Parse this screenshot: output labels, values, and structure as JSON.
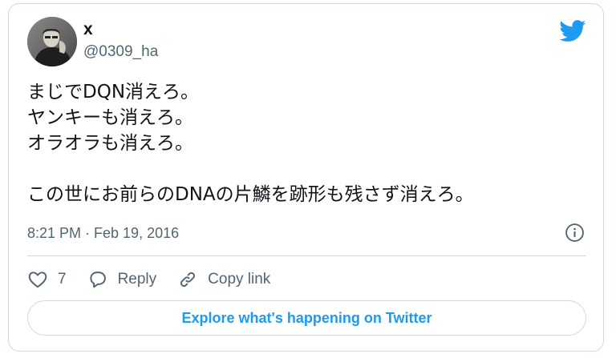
{
  "author": {
    "display_name": "x",
    "handle": "@0309_ha",
    "avatar_icon": "profile-photo"
  },
  "brand": {
    "logo_icon": "twitter-bird-icon",
    "accent_color": "#1d9bf0"
  },
  "tweet": {
    "lines": [
      "まじでDQN消えろ。",
      "ヤンキーも消えろ。",
      "オラオラも消えろ。",
      "",
      "この世にお前らのDNAの片鱗を跡形も残さず消えろ。"
    ],
    "timestamp": "8:21 PM · Feb 19, 2016"
  },
  "actions": {
    "like_count": "7",
    "reply_label": "Reply",
    "copy_link_label": "Copy link"
  },
  "footer": {
    "explore_label": "Explore what's happening on Twitter"
  }
}
